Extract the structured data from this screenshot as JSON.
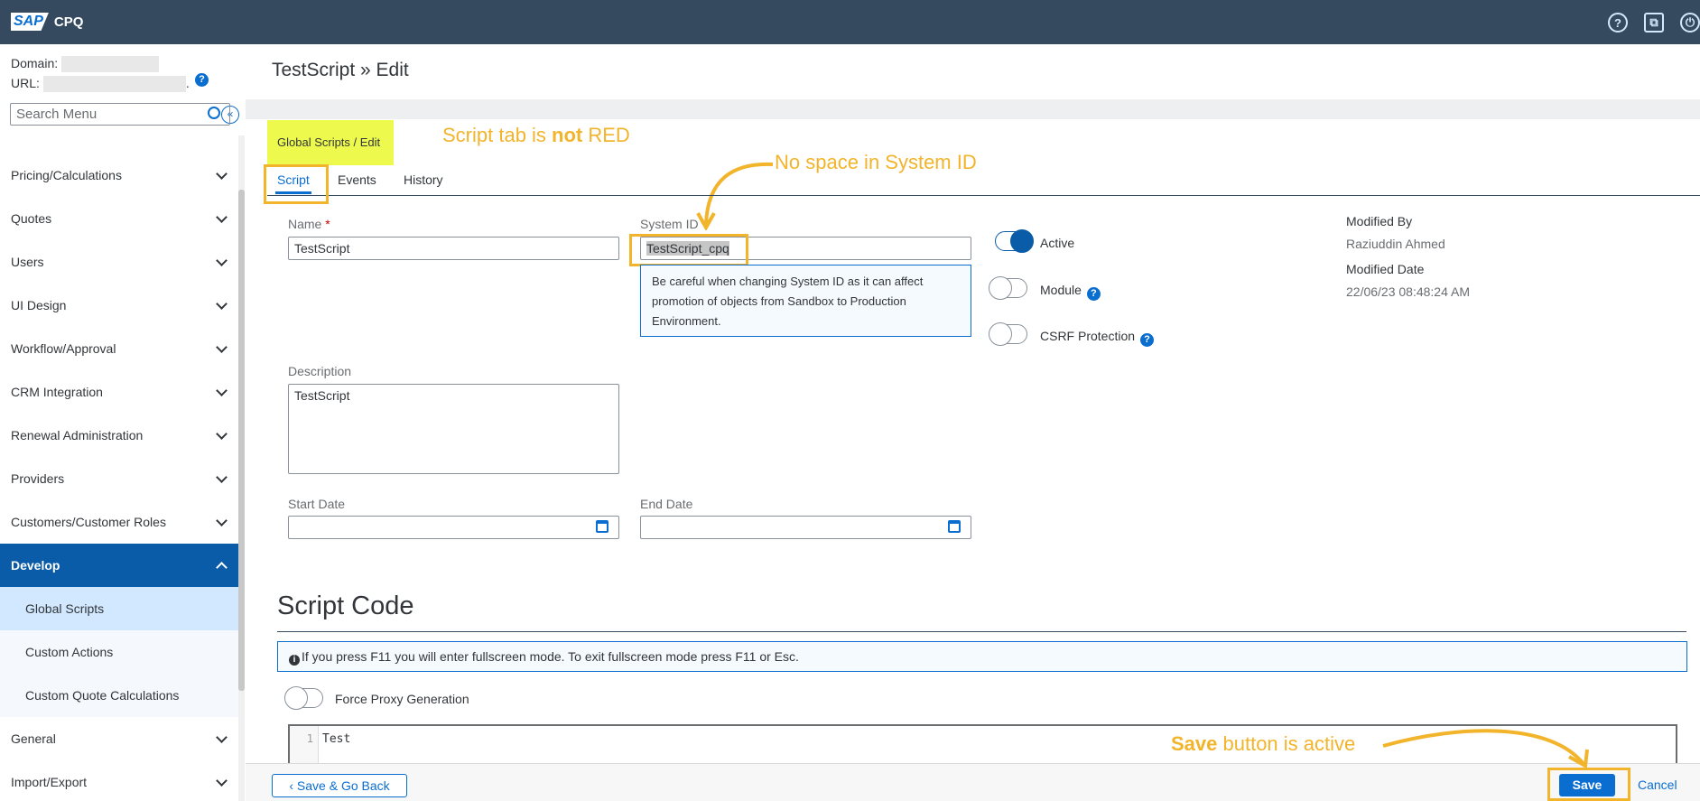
{
  "topbar": {
    "logo_sap": "SAP",
    "logo_product": "CPQ",
    "icons": [
      "help-icon",
      "open-window-icon",
      "power-icon"
    ]
  },
  "sidebar": {
    "domain_label": "Domain:",
    "url_label": "URL:",
    "url_suffix": ".",
    "help": "?",
    "collapse": "«",
    "search_placeholder": "Search Menu",
    "items": [
      {
        "label": "Pricing/Calculations"
      },
      {
        "label": "Quotes"
      },
      {
        "label": "Users"
      },
      {
        "label": "UI Design"
      },
      {
        "label": "Workflow/Approval"
      },
      {
        "label": "CRM Integration"
      },
      {
        "label": "Renewal Administration"
      },
      {
        "label": "Providers"
      },
      {
        "label": "Customers/Customer Roles"
      },
      {
        "label": "Develop"
      },
      {
        "label": "Global Scripts"
      },
      {
        "label": "Custom Actions"
      },
      {
        "label": "Custom Quote Calculations"
      },
      {
        "label": "General"
      },
      {
        "label": "Import/Export"
      }
    ]
  },
  "main": {
    "title": "TestScript » Edit",
    "breadcrumb": "Global Scripts / Edit",
    "annotations": {
      "tab_note_prefix": "Script tab is ",
      "tab_note_bold": "not",
      "tab_note_suffix": " RED",
      "sysid_note": "No space in System ID",
      "save_note_bold": "Save",
      "save_note_suffix": " button is active"
    },
    "tabs": [
      {
        "label": "Script"
      },
      {
        "label": "Events"
      },
      {
        "label": "History"
      }
    ],
    "form": {
      "name_label": "Name",
      "name_required": "*",
      "name_value": "TestScript",
      "sysid_label": "System ID",
      "sysid_value": "TestScript_cpq",
      "sysid_info": "Be careful when changing System ID as it can affect promotion of objects from Sandbox to Production Environment.",
      "description_label": "Description",
      "description_value": "TestScript",
      "start_date_label": "Start Date",
      "end_date_label": "End Date",
      "active_label": "Active",
      "module_label": "Module",
      "csrf_label": "CSRF Protection",
      "q": "?",
      "modified_by_label": "Modified By",
      "modified_by_value": "Raziuddin Ahmed",
      "modified_date_label": "Modified Date",
      "modified_date_value": "22/06/23 08:48:24 AM"
    },
    "script_code": {
      "title": "Script Code",
      "info_icon": "i",
      "info": "If you press F11 you will enter fullscreen mode. To exit fullscreen mode press F11 or Esc.",
      "force_proxy_label": "Force Proxy Generation",
      "line_number": "1",
      "line_text": "Test"
    },
    "footer": {
      "save_back": "Save & Go Back",
      "save": "Save",
      "cancel": "Cancel"
    }
  }
}
